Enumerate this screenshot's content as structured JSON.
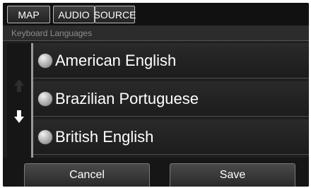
{
  "tabs": [
    {
      "label": "MAP"
    },
    {
      "label": "AUDIO"
    },
    {
      "label": "SOURCE"
    }
  ],
  "subtitle": "Keyboard Languages",
  "languages": [
    {
      "label": "American English",
      "selected": false
    },
    {
      "label": "Brazilian Portuguese",
      "selected": false
    },
    {
      "label": "British English",
      "selected": false
    }
  ],
  "scroll": {
    "up_icon": "arrow-up-icon",
    "up_enabled": false,
    "down_icon": "arrow-down-icon",
    "down_enabled": true
  },
  "buttons": {
    "cancel": "Cancel",
    "save": "Save"
  },
  "colors": {
    "background": "#1f1f1f",
    "text": "#ffffff",
    "subtitle": "#8c8c8c"
  }
}
